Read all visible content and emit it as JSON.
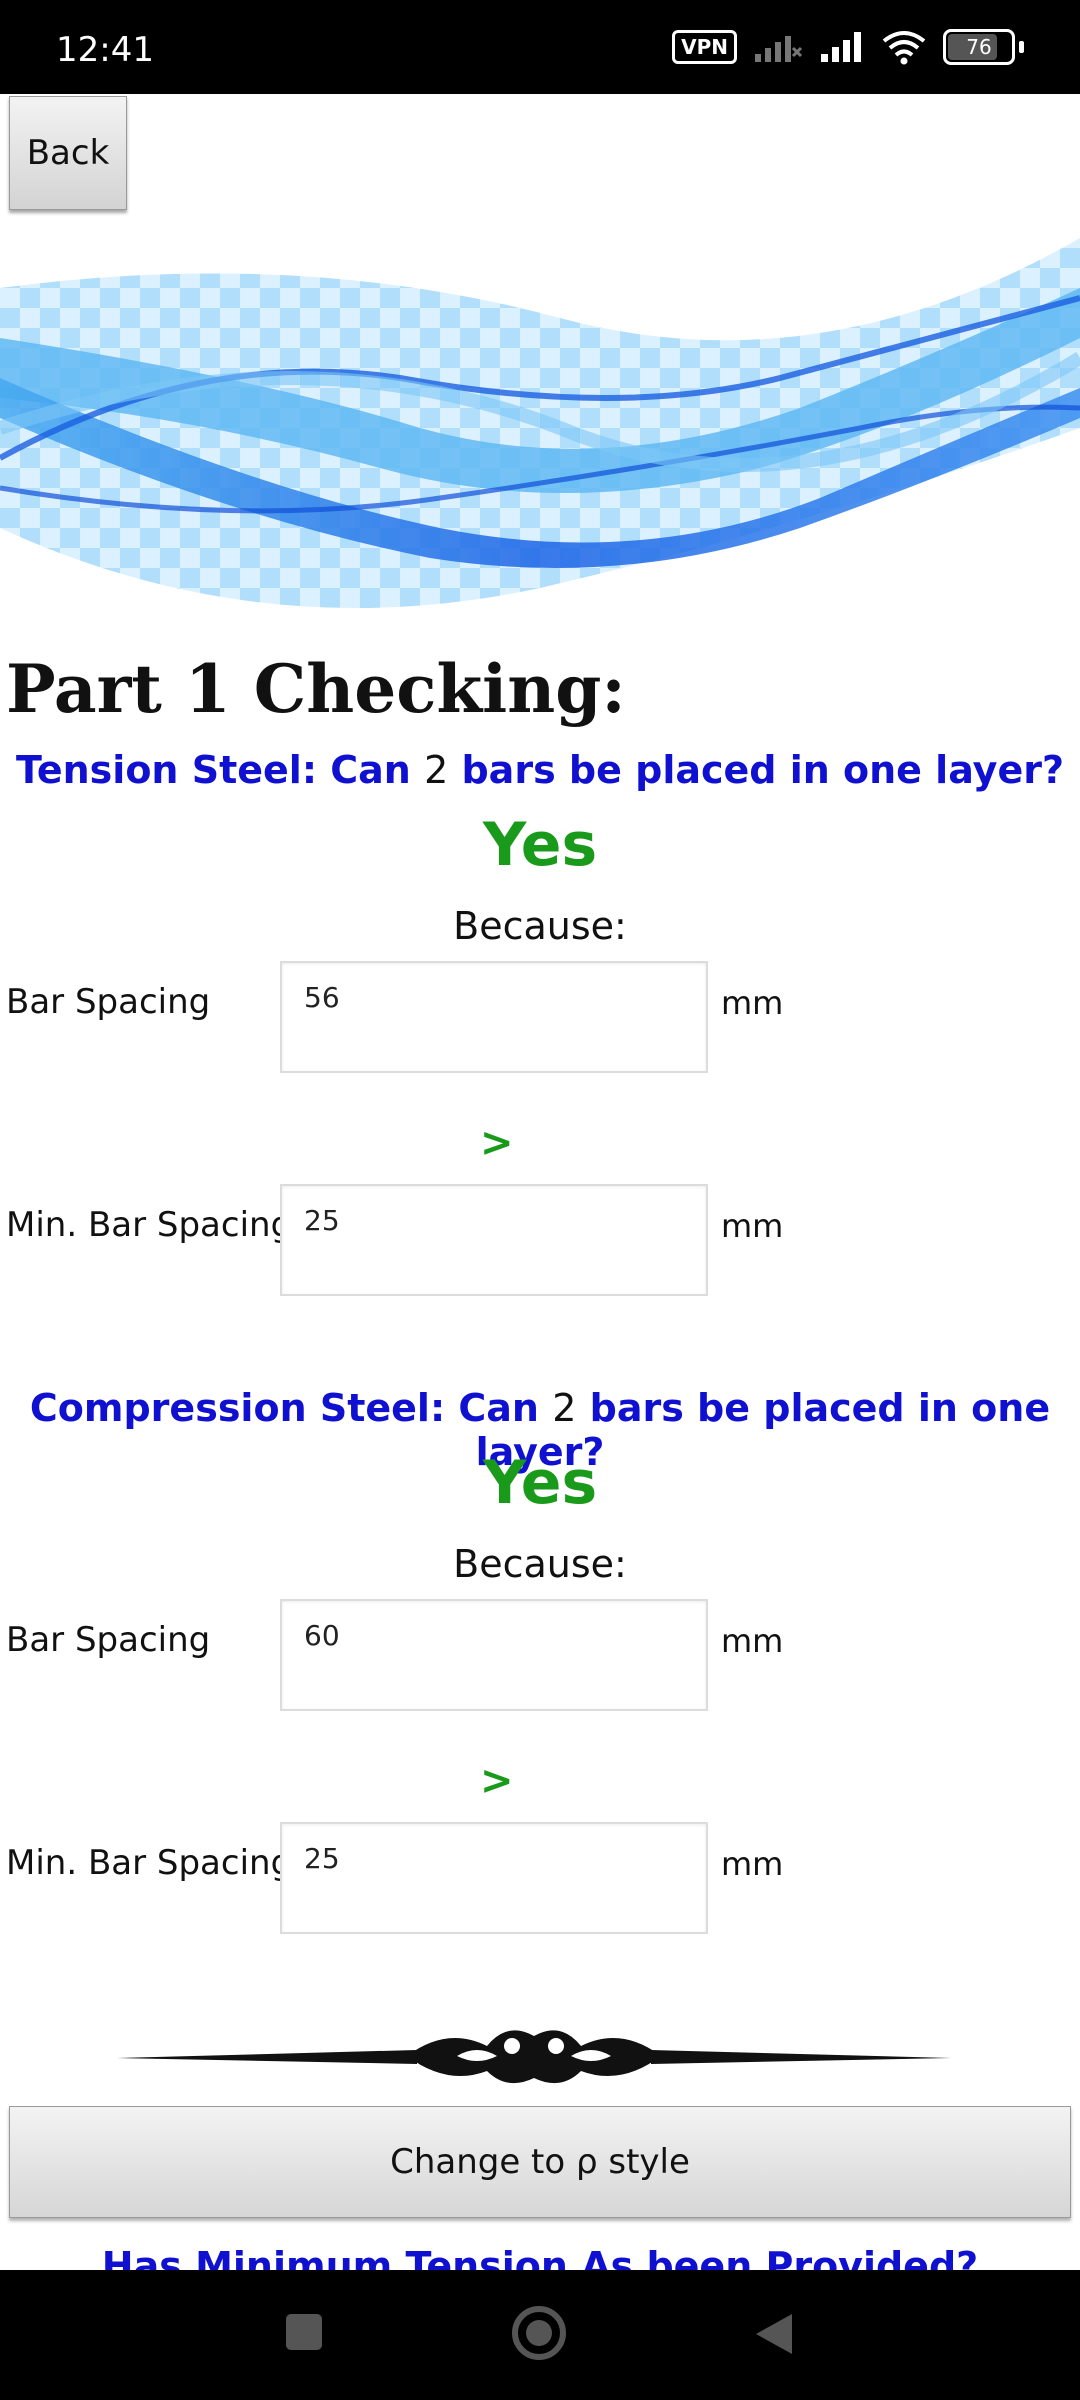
{
  "status_bar": {
    "time": "12:41",
    "vpn_label": "VPN",
    "battery_level": "76",
    "icons": [
      "vpn-icon",
      "no-signal-icon",
      "signal-icon",
      "wifi-icon",
      "battery-icon"
    ]
  },
  "back_button": {
    "label": "Back"
  },
  "page_title": "Part 1 Checking:",
  "tension": {
    "question_prefix": "Tension Steel:  Can",
    "count": "2",
    "question_suffix": "bars be placed in one layer?",
    "answer": "Yes",
    "because": "Because:",
    "bar_spacing_label": "Bar Spacing",
    "bar_spacing_value": "56",
    "comparator": ">",
    "min_spacing_label": "Min. Bar Spacing",
    "min_spacing_value": "25",
    "unit": "mm"
  },
  "compression": {
    "question_prefix": "Compression Steel:  Can",
    "count": "2",
    "question_suffix": "bars be placed in one layer?",
    "answer": "Yes",
    "because": "Because:",
    "bar_spacing_label": "Bar Spacing",
    "bar_spacing_value": "60",
    "comparator": ">",
    "min_spacing_label": "Min. Bar Spacing",
    "min_spacing_value": "25",
    "unit": "mm"
  },
  "change_button": {
    "label": "Change to ρ style"
  },
  "next_heading": "Has Minimum Tension As been Provided?",
  "colors": {
    "question_blue": "#1010d0",
    "answer_green": "#1a9a1a",
    "wave_blue": "#1f6fe8"
  }
}
